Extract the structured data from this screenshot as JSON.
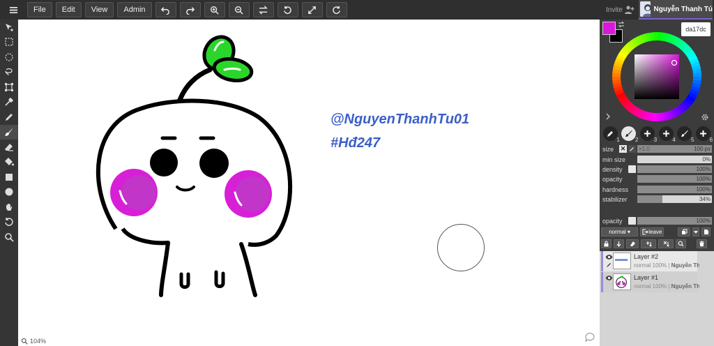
{
  "menu": {
    "file": "File",
    "edit": "Edit",
    "view": "View",
    "admin": "Admin"
  },
  "header": {
    "invite": "Invite",
    "username": "Nguyễn Thanh Tú"
  },
  "canvas": {
    "watermark_line1": "@NguyenThanhTu01",
    "watermark_line2": "#Hđ247",
    "zoom": "104%"
  },
  "colors": {
    "primary": "#da17dc",
    "secondary": "#000000",
    "hex_value": "da17dc"
  },
  "brushes": [
    {
      "num": "1",
      "icon": "pen-plus-icon"
    },
    {
      "num": "2",
      "icon": "brush-icon"
    },
    {
      "num": "3",
      "icon": "plus-icon"
    },
    {
      "num": "4",
      "icon": "plus-icon"
    },
    {
      "num": "5",
      "icon": "brush-icon"
    },
    {
      "num": "6",
      "icon": "plus-icon"
    }
  ],
  "settings": {
    "size": {
      "label": "size",
      "prefix": "×1.0",
      "value": "100 px",
      "fraction": 1.0
    },
    "min_size": {
      "label": "min size",
      "value": "0%",
      "fraction": 0.0
    },
    "density": {
      "label": "density",
      "value": "100%",
      "fraction": 1.0
    },
    "opacity": {
      "label": "opacity",
      "value": "100%",
      "fraction": 1.0
    },
    "hardness": {
      "label": "hardness",
      "value": "100%",
      "fraction": 1.0
    },
    "stabilizer": {
      "label": "stabilizer",
      "value": "34%",
      "fraction": 0.34
    }
  },
  "layer_opacity": {
    "label": "opacity",
    "value": "100%",
    "fraction": 1.0
  },
  "blend": {
    "mode": "normal ▾",
    "leave": "leave"
  },
  "layers": [
    {
      "name": "Layer #2",
      "meta": "normal 100% | ",
      "owner": "Nguyễn Th..."
    },
    {
      "name": "Layer #1",
      "meta": "normal 100% | ",
      "owner": "Nguyễn Th..."
    }
  ]
}
